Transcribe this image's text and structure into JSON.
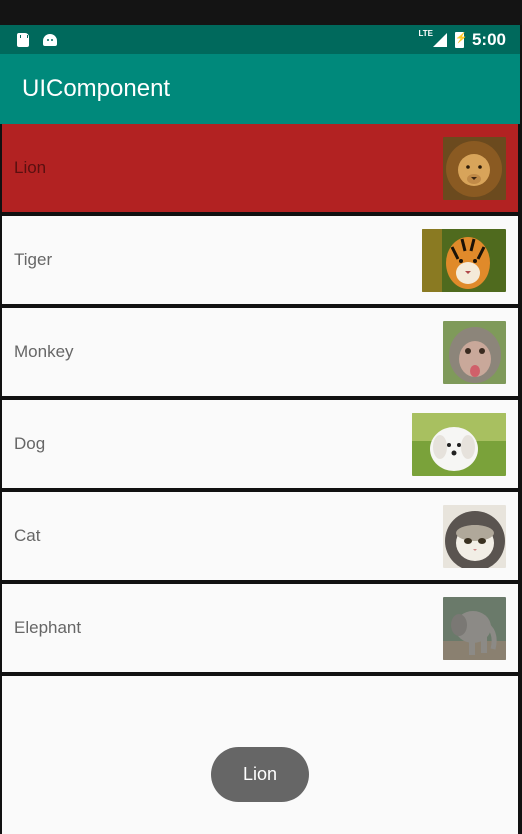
{
  "status_bar": {
    "network": "LTE",
    "time": "5:00"
  },
  "app_bar": {
    "title": "UIComponent"
  },
  "animals": [
    {
      "name": "Lion",
      "image": "lion-photo",
      "selected": true
    },
    {
      "name": "Tiger",
      "image": "tiger-photo",
      "selected": false
    },
    {
      "name": "Monkey",
      "image": "monkey-photo",
      "selected": false
    },
    {
      "name": "Dog",
      "image": "dog-photo",
      "selected": false
    },
    {
      "name": "Cat",
      "image": "cat-photo",
      "selected": false
    },
    {
      "name": "Elephant",
      "image": "elephant-photo",
      "selected": false
    }
  ],
  "toast": {
    "text": "Lion"
  },
  "colors": {
    "status_bar": "#00695c",
    "app_bar": "#00897b",
    "selected_row": "#b22222"
  }
}
